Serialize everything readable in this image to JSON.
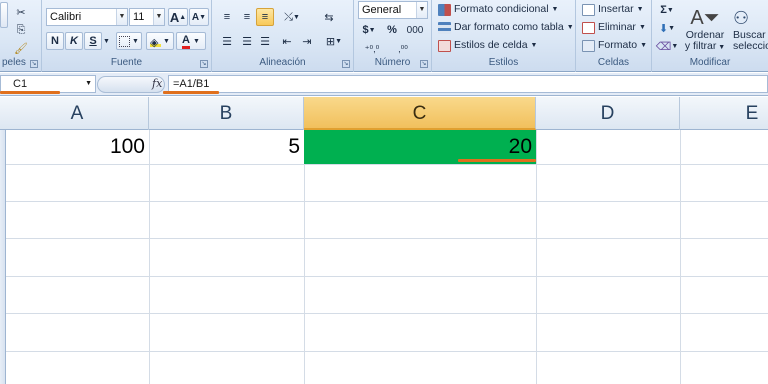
{
  "ribbon": {
    "clipboard": {
      "label": "peles"
    },
    "font": {
      "label": "Fuente",
      "font_name": "Calibri",
      "font_size": "11",
      "grow": "A",
      "shrink": "A",
      "bold": "N",
      "italic": "K",
      "underline": "S",
      "font_color_letter": "A"
    },
    "alignment": {
      "label": "Alineación"
    },
    "number": {
      "label": "Número",
      "format": "General",
      "currency": "$",
      "percent": "%",
      "thousands": "000",
      "dec_inc": "⁺⁰,⁰",
      "dec_dec": ",⁰⁰"
    },
    "styles": {
      "label": "Estilos",
      "conditional": "Formato condicional",
      "as_table": "Dar formato como tabla",
      "cell_styles": "Estilos de celda"
    },
    "cells": {
      "label": "Celdas",
      "insert": "Insertar",
      "delete": "Eliminar",
      "format": "Formato"
    },
    "editing": {
      "label": "Modificar",
      "sigma": "Σ",
      "sort_line1": "Ordenar",
      "sort_line2": "y filtrar",
      "find_line1": "Buscar",
      "find_line2": "seleccio"
    }
  },
  "formula_bar": {
    "name_box": "C1",
    "fx": "fx",
    "formula": "=A1/B1"
  },
  "columns": [
    "A",
    "B",
    "C",
    "D",
    "E"
  ],
  "active_column": "C",
  "cells": {
    "A1": "100",
    "B1": "5",
    "C1": "20"
  },
  "colors": {
    "highlight_fill": "#00b050",
    "annotation_underline": "#e0701c"
  }
}
